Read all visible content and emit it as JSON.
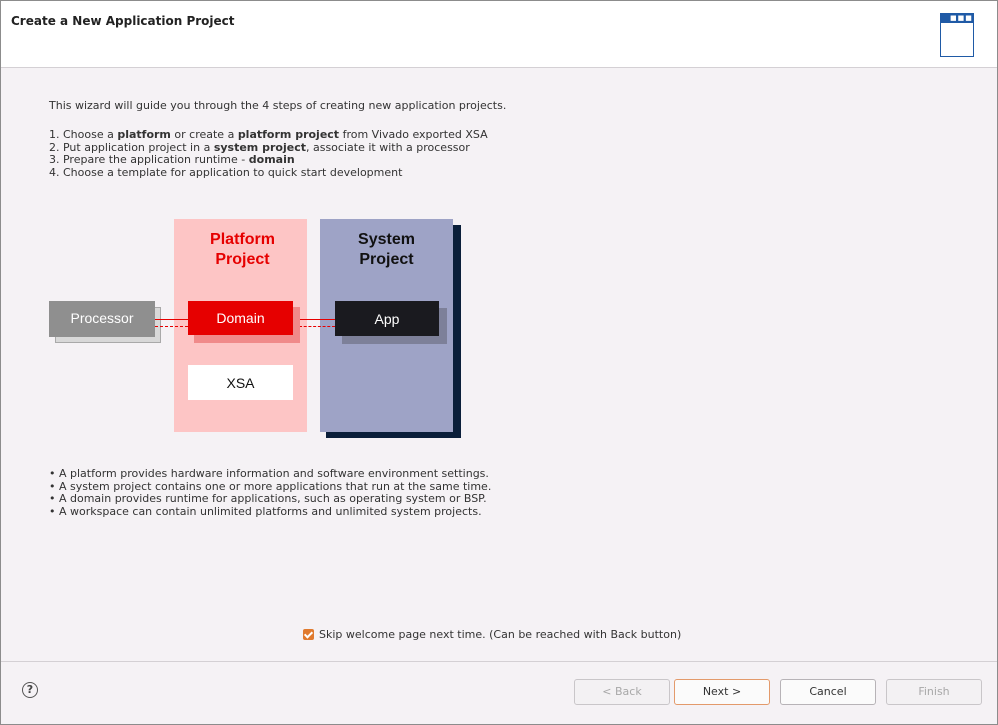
{
  "window": {
    "title": "Create a New Application Project"
  },
  "intro": "This wizard will guide you through the 4 steps of creating new application projects.",
  "steps": [
    {
      "pre": "1.  Choose a ",
      "b1": "platform",
      "mid": " or create a ",
      "b2": "platform project",
      "post": " from Vivado exported XSA"
    },
    {
      "pre": "2.  Put application project in a ",
      "b1": "system project",
      "mid": ", associate it with a processor",
      "b2": "",
      "post": ""
    },
    {
      "pre": "3.  Prepare the application runtime - ",
      "b1": "domain",
      "mid": "",
      "b2": "",
      "post": ""
    },
    {
      "pre": "4.  Choose a template for application to quick start development",
      "b1": "",
      "mid": "",
      "b2": "",
      "post": ""
    }
  ],
  "diagram": {
    "platform_title_1": "Platform",
    "platform_title_2": "Project",
    "system_title_1": "System",
    "system_title_2": "Project",
    "processor": "Processor",
    "domain": "Domain",
    "app": "App",
    "xsa": "XSA",
    "colors": {
      "platform_bg": "#fdc5c5",
      "platform_text": "#e60000",
      "system_bg": "#9ea3c6",
      "system_shadow": "#0b1f3a",
      "domain": "#e60000",
      "app": "#1a1a1f",
      "processor": "#8f8f8f"
    }
  },
  "bullets": [
    "• A platform provides hardware information and software environment settings.",
    "• A system project contains one or more applications that run at the same time.",
    "• A domain provides runtime for applications, such as operating system or BSP.",
    "• A workspace can contain unlimited platforms and unlimited system projects."
  ],
  "skip_checkbox": {
    "label": "Skip welcome page next time. (Can be reached with Back button)",
    "checked": true
  },
  "footer": {
    "help_icon": "?",
    "back": "< Back",
    "next": "Next >",
    "cancel": "Cancel",
    "finish": "Finish"
  }
}
